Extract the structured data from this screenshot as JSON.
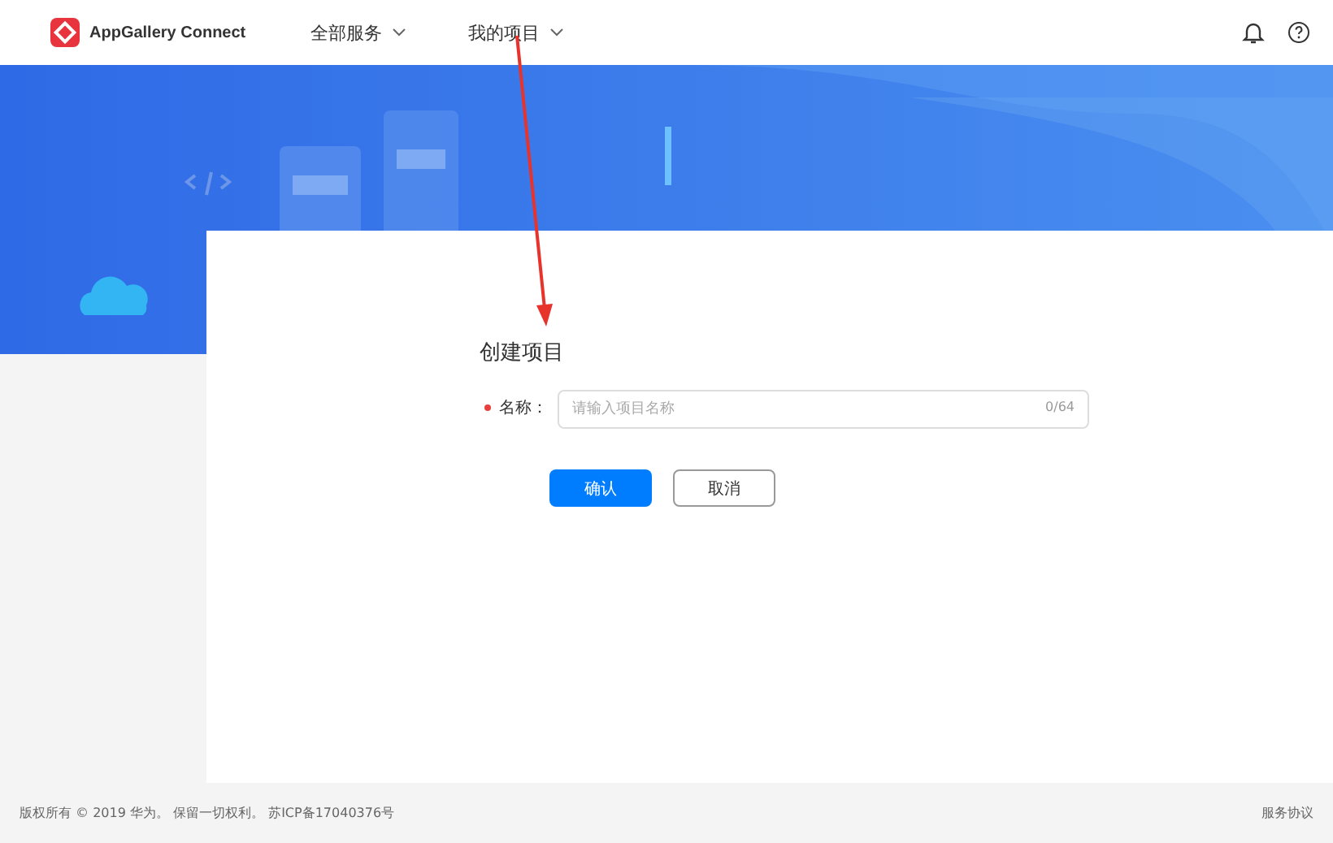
{
  "header": {
    "logo_text": "AppGallery Connect",
    "nav": [
      {
        "label": "全部服务"
      },
      {
        "label": "我的项目"
      }
    ]
  },
  "form": {
    "title": "创建项目",
    "fields": [
      {
        "label": "名称：",
        "required": true,
        "placeholder": "请输入项目名称",
        "counter": "0/64"
      }
    ],
    "buttons": [
      {
        "label": "确认",
        "kind": "primary"
      },
      {
        "label": "取消",
        "kind": "secondary"
      }
    ]
  },
  "footer": {
    "copyright": "版权所有 © 2019 华为。 保留一切权利。 苏ICP备17040376号",
    "links": [
      "服务协议"
    ]
  }
}
